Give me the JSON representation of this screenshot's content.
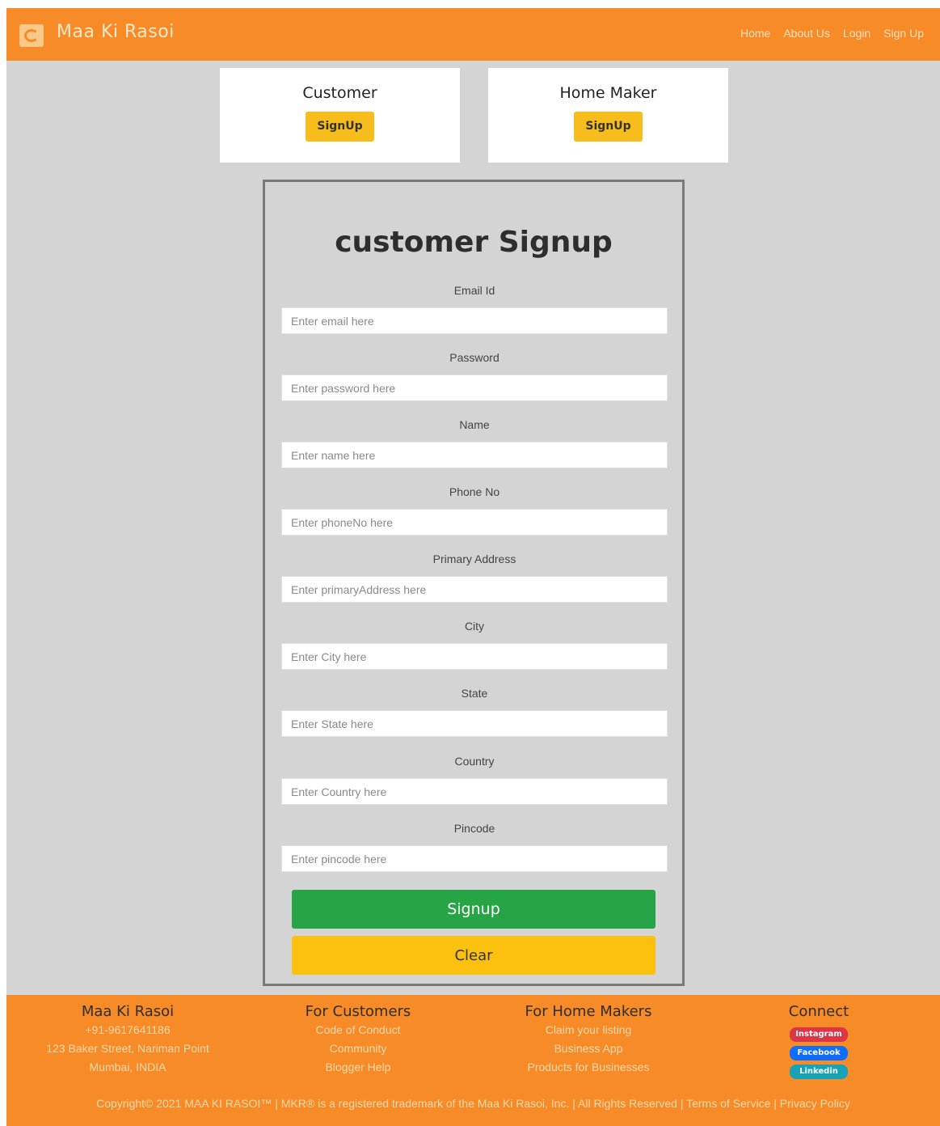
{
  "header": {
    "brand": "Maa Ki Rasoi",
    "nav": [
      "Home",
      "About Us",
      "Login",
      "Sign Up"
    ]
  },
  "role_cards": {
    "customer": {
      "title": "Customer",
      "button": "SignUp"
    },
    "homemaker": {
      "title": "Home Maker",
      "button": "SignUp"
    }
  },
  "form": {
    "title": "customer Signup",
    "fields": [
      {
        "label": "Email Id",
        "placeholder": "Enter email here"
      },
      {
        "label": "Password",
        "placeholder": "Enter password here"
      },
      {
        "label": "Name",
        "placeholder": "Enter name here"
      },
      {
        "label": "Phone No",
        "placeholder": "Enter phoneNo here"
      },
      {
        "label": "Primary Address",
        "placeholder": "Enter primaryAddress here"
      },
      {
        "label": "City",
        "placeholder": "Enter City here"
      },
      {
        "label": "State",
        "placeholder": "Enter State here"
      },
      {
        "label": "Country",
        "placeholder": "Enter Country here"
      },
      {
        "label": "Pincode",
        "placeholder": "Enter pincode here"
      }
    ],
    "signup_label": "Signup",
    "clear_label": "Clear"
  },
  "footer": {
    "about": {
      "heading": "Maa Ki Rasoi",
      "lines": [
        "+91-9617641186",
        "123 Baker Street, Nariman Point",
        "Mumbai, INDIA"
      ]
    },
    "customers": {
      "heading": "For Customers",
      "links": [
        "Code of Conduct",
        "Community",
        "Blogger Help"
      ]
    },
    "homemakers": {
      "heading": "For Home Makers",
      "links": [
        "Claim your listing",
        "Business App",
        "Products for Businesses"
      ]
    },
    "connect": {
      "heading": "Connect",
      "social": [
        {
          "label": "Instagram",
          "color": "#dc3545"
        },
        {
          "label": "Facebook",
          "color": "#0d6efd"
        },
        {
          "label": "Linkedin",
          "color": "#17a2b8"
        }
      ]
    },
    "copyright": "Copyright© 2021 MAA KI RASOI™ | MKR® is a registered trademark of the Maa Ki Rasoi, Inc. | All Rights Reserved |",
    "terms": "Terms of Service",
    "privacy": "Privacy Policy"
  },
  "colors": {
    "nav_bg": "#f68b27",
    "page_bg": "#d4d4d4",
    "signup_green": "#27a445",
    "clear_yellow": "#fcc10f",
    "role_button_yellow": "#f7bd1c"
  }
}
